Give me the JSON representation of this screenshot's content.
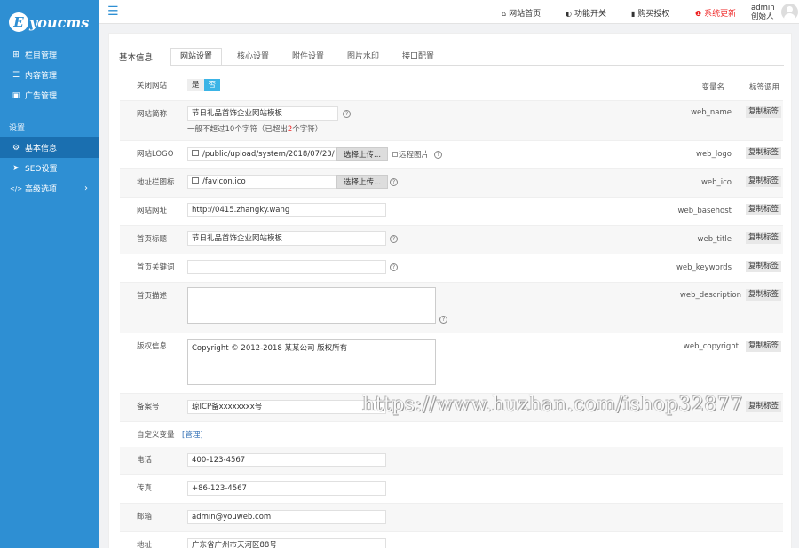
{
  "brand": {
    "logo_letter": "E",
    "logo_text": "youcms"
  },
  "sidebar": {
    "items": [
      {
        "label": "栏目管理",
        "icon": "sitemap-icon",
        "glyph": "⊞"
      },
      {
        "label": "内容管理",
        "icon": "list-icon",
        "glyph": "☰"
      },
      {
        "label": "广告管理",
        "icon": "image-icon",
        "glyph": "▣"
      }
    ],
    "section_label": "设置",
    "settings_items": [
      {
        "label": "基本信息",
        "icon": "gear-icon",
        "glyph": "⚙",
        "active": true
      },
      {
        "label": "SEO设置",
        "icon": "send-icon",
        "glyph": "➤"
      },
      {
        "label": "高级选项",
        "icon": "code-icon",
        "glyph": "</>",
        "arrow": "›"
      }
    ]
  },
  "topbar": {
    "links": [
      {
        "label": "网站首页",
        "icon": "home-icon",
        "glyph": "⌂"
      },
      {
        "label": "功能开关",
        "icon": "toggle-icon",
        "glyph": "◐"
      },
      {
        "label": "购买授权",
        "icon": "bookmark-icon",
        "glyph": "▮"
      },
      {
        "label": "系统更新",
        "icon": "info-icon",
        "glyph": "❶"
      }
    ],
    "user_name": "admin",
    "user_role": "创始人"
  },
  "panel": {
    "title": "基本信息",
    "tabs": [
      "网站设置",
      "核心设置",
      "附件设置",
      "图片水印",
      "接口配置"
    ],
    "active_tab": 0
  },
  "header": {
    "varname": "变量名",
    "tagcall": "标签调用"
  },
  "copy_label": "复制标签",
  "qmark": "?",
  "rows": {
    "close_site": {
      "label": "关闭网站",
      "yes": "是",
      "no": "否"
    },
    "site_name": {
      "label": "网站简称",
      "value": "节日礼品首饰企业网站模板",
      "hint_pre": "一般不超过10个字符（已超出",
      "hint_num": "2",
      "hint_post": "个字符）",
      "var": "web_name"
    },
    "site_logo": {
      "label": "网站LOGO",
      "value": "/public/upload/system/2018/07/23/",
      "upload": "选择上传...",
      "remote": "远程图片",
      "var": "web_logo"
    },
    "favicon": {
      "label": "地址栏图标",
      "value": "/favicon.ico",
      "upload": "选择上传...",
      "var": "web_ico"
    },
    "site_url": {
      "label": "网站网址",
      "value": "http://0415.zhangky.wang",
      "var": "web_basehost"
    },
    "home_title": {
      "label": "首页标题",
      "value": "节日礼品首饰企业网站模板",
      "var": "web_title"
    },
    "home_keywords": {
      "label": "首页关键词",
      "value": "",
      "var": "web_keywords"
    },
    "home_desc": {
      "label": "首页描述",
      "value": "",
      "var": "web_description"
    },
    "copyright": {
      "label": "版权信息",
      "value": "Copyright © 2012-2018 某某公司 版权所有",
      "var": "web_copyright"
    },
    "icp": {
      "label": "备案号",
      "value": "琼ICP备xxxxxxxx号"
    },
    "custom_vars": {
      "label": "自定义变量",
      "link": "[管理]"
    },
    "phone": {
      "label": "电话",
      "value": "400-123-4567"
    },
    "fax": {
      "label": "传真",
      "value": "+86-123-4567"
    },
    "email": {
      "label": "邮箱",
      "value": "admin@youweb.com"
    },
    "address": {
      "label": "地址",
      "value": "广东省广州市天河区88号"
    }
  },
  "watermark": "https://www.huzhan.com/ishop32877"
}
